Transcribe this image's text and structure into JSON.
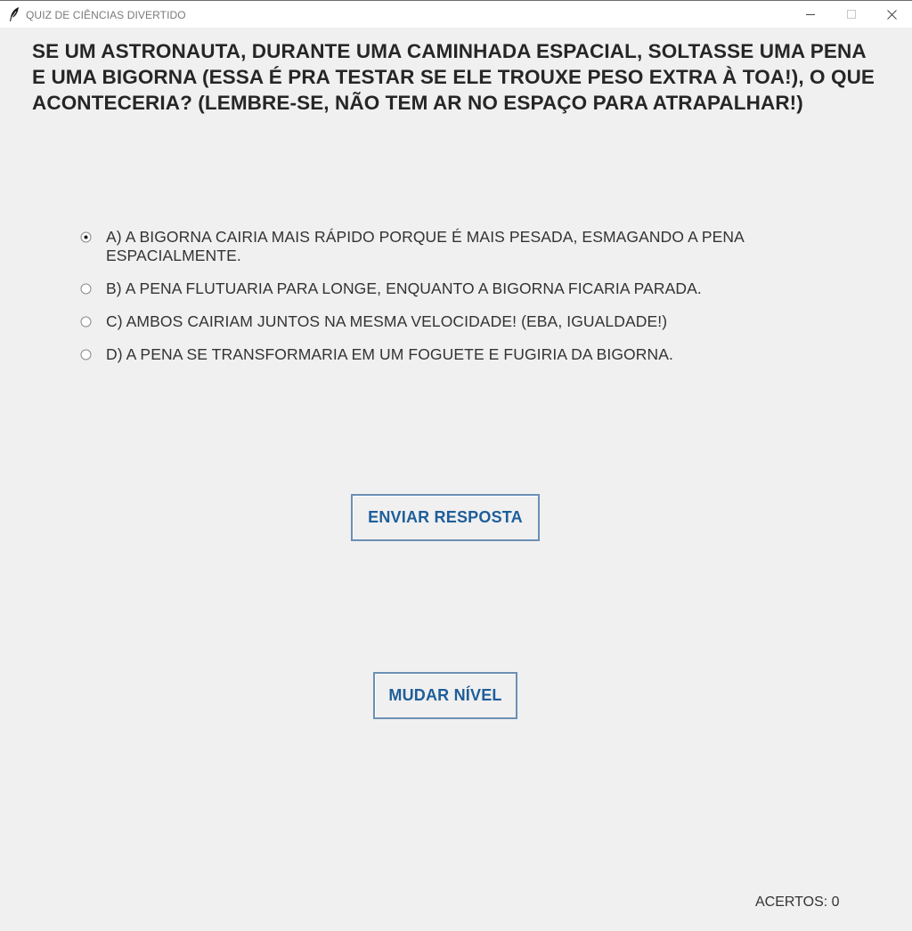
{
  "window": {
    "title": "QUIZ DE CIÊNCIAS DIVERTIDO",
    "app_icon": "feather-icon",
    "controls": {
      "minimize": "minimize-icon",
      "maximize": "maximize-icon",
      "close": "close-icon"
    }
  },
  "quiz": {
    "question": "SE UM ASTRONAUTA, DURANTE UMA CAMINHADA ESPACIAL, SOLTASSE UMA PENA E UMA BIGORNA (ESSA É PRA TESTAR SE ELE TROUXE PESO EXTRA À TOA!), O QUE ACONTECERIA? (LEMBRE-SE, NÃO TEM AR NO ESPAÇO PARA ATRAPALHAR!)",
    "options": [
      {
        "label": "A) A BIGORNA CAIRIA MAIS RÁPIDO PORQUE É MAIS PESADA, ESMAGANDO A PENA ESPACIALMENTE.",
        "selected": true
      },
      {
        "label": "B) A PENA FLUTUARIA PARA LONGE, ENQUANTO A BIGORNA FICARIA PARADA.",
        "selected": false
      },
      {
        "label": "C) AMBOS CAIRIAM JUNTOS NA MESMA VELOCIDADE! (EBA, IGUALDADE!)",
        "selected": false
      },
      {
        "label": "D) A PENA SE TRANSFORMARIA EM UM FOGUETE E FUGIRIA DA BIGORNA.",
        "selected": false
      }
    ],
    "submit_label": "ENVIAR RESPOSTA",
    "change_level_label": "MUDAR NÍVEL",
    "score_text": "ACERTOS: 0"
  },
  "colors": {
    "background": "#f0f0f0",
    "button_text": "#1e5e9a",
    "button_border": "#6b8fb5",
    "text": "#333333"
  }
}
